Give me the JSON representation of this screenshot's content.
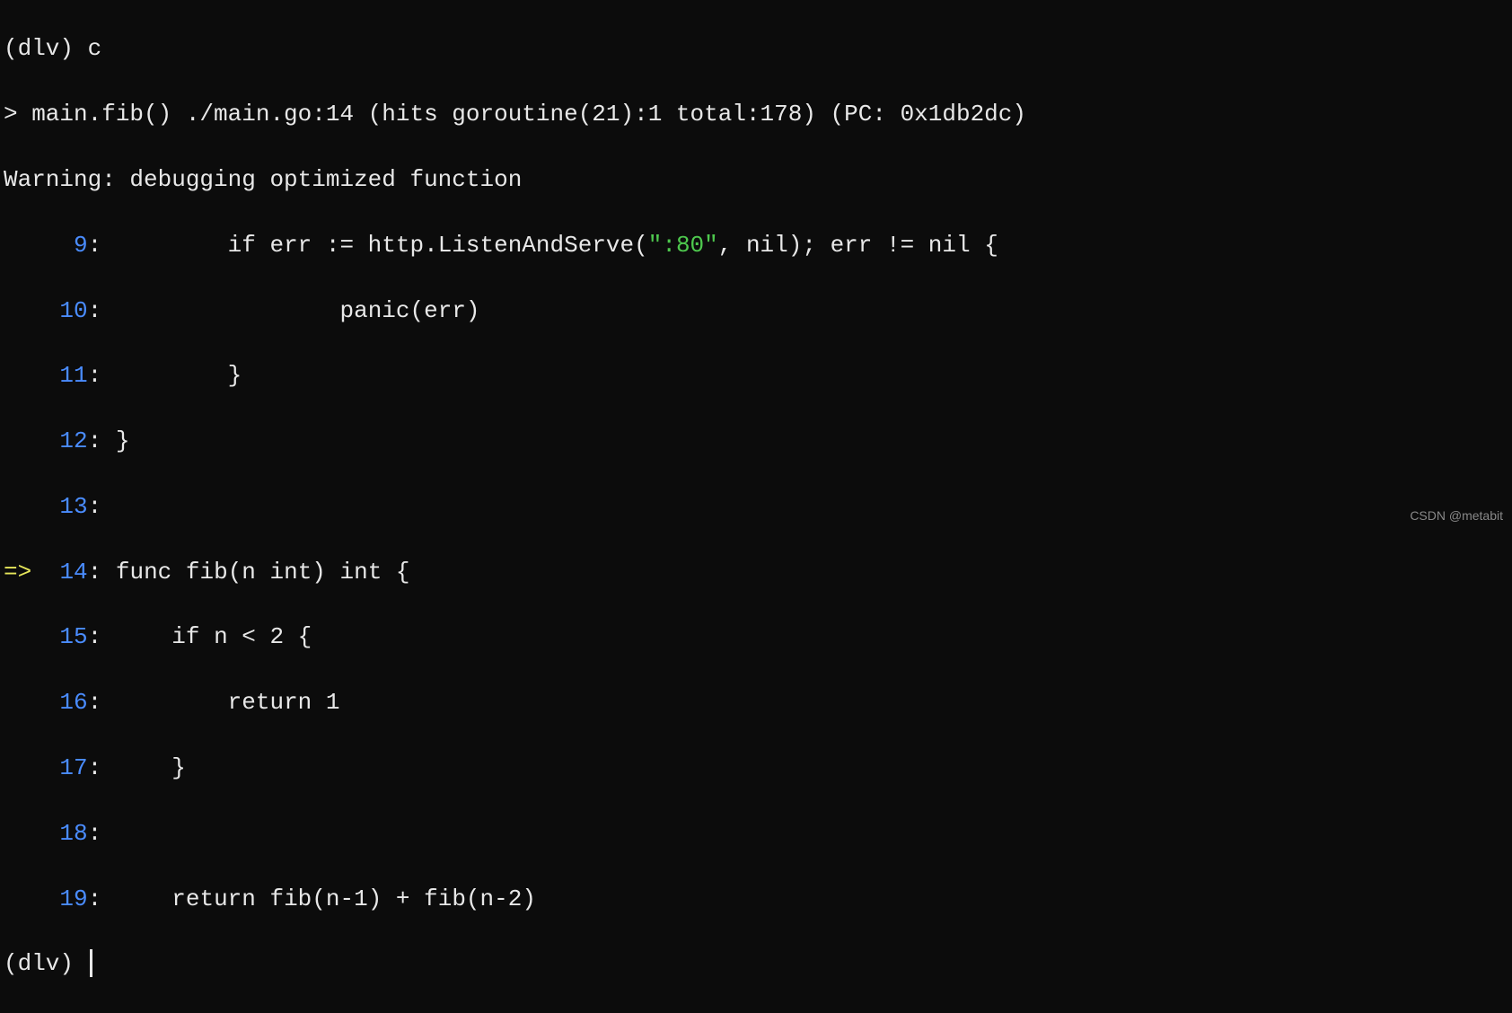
{
  "header": {
    "partial_top": "",
    "prompt1": "(dlv) c",
    "break_line": "> main.fib() ./main.go:14 (hits goroutine(21):1 total:178) (PC: 0x1db2dc)",
    "warning": "Warning: debugging optimized function"
  },
  "source": {
    "arrow": "=>",
    "lines": [
      {
        "num": "9",
        "prefix": "     ",
        "suffix": ":",
        "code_before": "         if err := http.ListenAndServe(",
        "string_literal": "\":80\"",
        "code_after": ", nil); err != nil {"
      },
      {
        "num": "10",
        "prefix": "    ",
        "suffix": ":",
        "code": "                 panic(err)"
      },
      {
        "num": "11",
        "prefix": "    ",
        "suffix": ":",
        "code": "         }"
      },
      {
        "num": "12",
        "prefix": "    ",
        "suffix": ":",
        "code": " }"
      },
      {
        "num": "13",
        "prefix": "    ",
        "suffix": ":",
        "code": ""
      },
      {
        "num": "14",
        "prefix": "  ",
        "suffix": ":",
        "code": " func fib(n int) int {"
      },
      {
        "num": "15",
        "prefix": "    ",
        "suffix": ":",
        "code": "     if n < 2 {"
      },
      {
        "num": "16",
        "prefix": "    ",
        "suffix": ":",
        "code": "         return 1"
      },
      {
        "num": "17",
        "prefix": "    ",
        "suffix": ":",
        "code": "     }"
      },
      {
        "num": "18",
        "prefix": "    ",
        "suffix": ":",
        "code": ""
      },
      {
        "num": "19",
        "prefix": "    ",
        "suffix": ":",
        "code": "     return fib(n-1) + fib(n-2)"
      }
    ]
  },
  "footer": {
    "prompt2": "(dlv) "
  },
  "watermark": "CSDN @metabit"
}
